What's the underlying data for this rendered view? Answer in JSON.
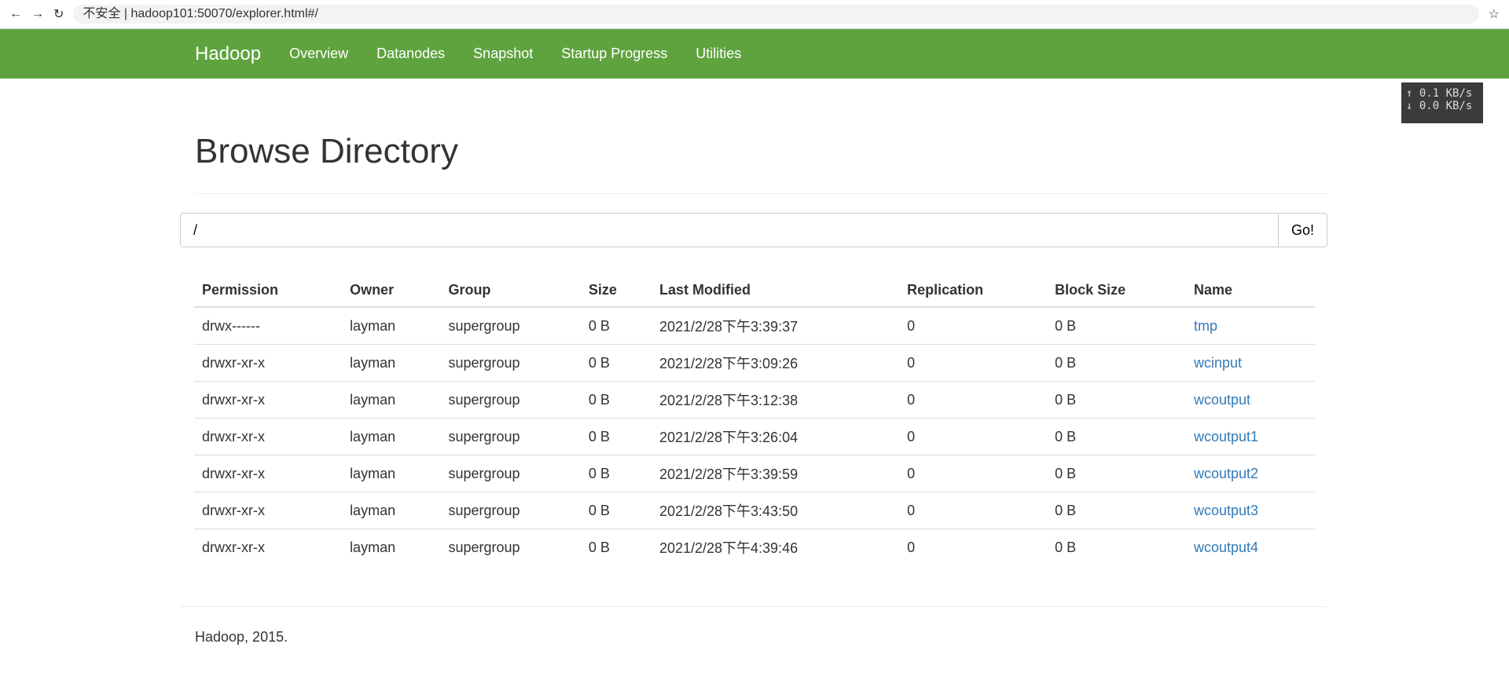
{
  "browser": {
    "url": "hadoop101:50070/explorer.html#/",
    "secure": "不安全"
  },
  "nav": {
    "brand": "Hadoop",
    "items": [
      "Overview",
      "Datanodes",
      "Snapshot",
      "Startup Progress",
      "Utilities"
    ]
  },
  "speed": {
    "up": "↑ 0.1 KB/s",
    "down": "↓ 0.0 KB/s"
  },
  "page": {
    "title": "Browse Directory",
    "path": "/",
    "go": "Go!"
  },
  "table": {
    "headers": [
      "Permission",
      "Owner",
      "Group",
      "Size",
      "Last Modified",
      "Replication",
      "Block Size",
      "Name"
    ],
    "rows": [
      [
        "drwx------",
        "layman",
        "supergroup",
        "0 B",
        "2021/2/28下午3:39:37",
        "0",
        "0 B",
        "tmp"
      ],
      [
        "drwxr-xr-x",
        "layman",
        "supergroup",
        "0 B",
        "2021/2/28下午3:09:26",
        "0",
        "0 B",
        "wcinput"
      ],
      [
        "drwxr-xr-x",
        "layman",
        "supergroup",
        "0 B",
        "2021/2/28下午3:12:38",
        "0",
        "0 B",
        "wcoutput"
      ],
      [
        "drwxr-xr-x",
        "layman",
        "supergroup",
        "0 B",
        "2021/2/28下午3:26:04",
        "0",
        "0 B",
        "wcoutput1"
      ],
      [
        "drwxr-xr-x",
        "layman",
        "supergroup",
        "0 B",
        "2021/2/28下午3:39:59",
        "0",
        "0 B",
        "wcoutput2"
      ],
      [
        "drwxr-xr-x",
        "layman",
        "supergroup",
        "0 B",
        "2021/2/28下午3:43:50",
        "0",
        "0 B",
        "wcoutput3"
      ],
      [
        "drwxr-xr-x",
        "layman",
        "supergroup",
        "0 B",
        "2021/2/28下午4:39:46",
        "0",
        "0 B",
        "wcoutput4"
      ]
    ]
  },
  "footer": "Hadoop, 2015."
}
